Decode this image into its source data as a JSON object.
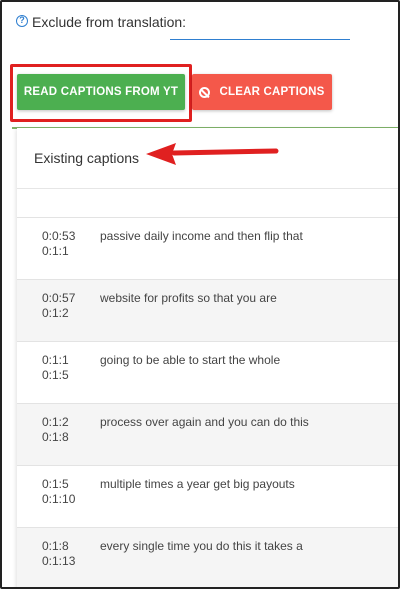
{
  "exclude": {
    "label": "Exclude from translation:",
    "help_glyph": "?",
    "value": ""
  },
  "buttons": {
    "read_label": "READ CAPTIONS FROM YT",
    "clear_label": "CLEAR CAPTIONS"
  },
  "captions": {
    "title": "Existing captions",
    "rows": [
      {
        "start": "0:0:53",
        "end": "0:1:1",
        "text": "passive daily income and then flip that"
      },
      {
        "start": "0:0:57",
        "end": "0:1:2",
        "text": "website for profits so that you are"
      },
      {
        "start": "0:1:1",
        "end": "0:1:5",
        "text": "going to be able to start the whole"
      },
      {
        "start": "0:1:2",
        "end": "0:1:8",
        "text": "process over again and you can do this"
      },
      {
        "start": "0:1:5",
        "end": "0:1:10",
        "text": "multiple times a year get big payouts"
      },
      {
        "start": "0:1:8",
        "end": "0:1:13",
        "text": "every single time you do this it takes a"
      }
    ]
  },
  "colors": {
    "read_button": "#4caf50",
    "clear_button": "#f4584a",
    "highlight": "#e02020",
    "accent": "#2f7fd0"
  }
}
